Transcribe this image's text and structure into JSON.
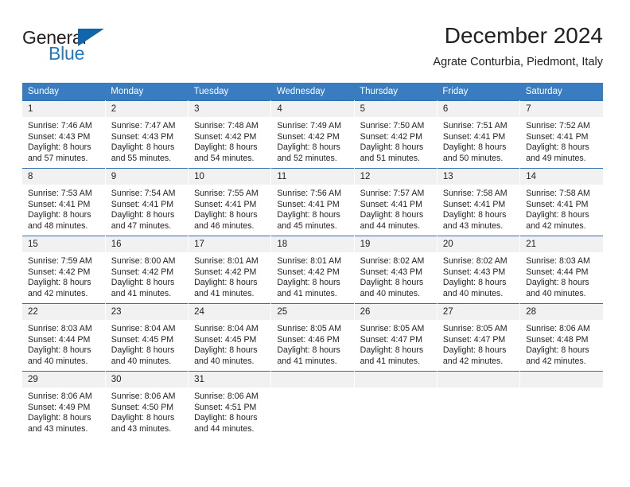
{
  "brand": {
    "name_top": "General",
    "name_bottom": "Blue",
    "triangle_icon": "blue-triangle-logo-mark",
    "accent_color": "#1166ab",
    "text_color": "#231f20"
  },
  "header": {
    "title": "December 2024",
    "location": "Agrate Conturbia, Piedmont, Italy"
  },
  "calendar": {
    "header_bg": "#3a7cc0",
    "header_text_color": "#ffffff",
    "daynum_bg": "#f1f1f1",
    "row_divider_color": "#2f6fb5",
    "weekdays": [
      "Sunday",
      "Monday",
      "Tuesday",
      "Wednesday",
      "Thursday",
      "Friday",
      "Saturday"
    ],
    "weeks": [
      [
        {
          "day": "1",
          "sunrise": "Sunrise: 7:46 AM",
          "sunset": "Sunset: 4:43 PM",
          "daylight_1": "Daylight: 8 hours",
          "daylight_2": "and 57 minutes."
        },
        {
          "day": "2",
          "sunrise": "Sunrise: 7:47 AM",
          "sunset": "Sunset: 4:43 PM",
          "daylight_1": "Daylight: 8 hours",
          "daylight_2": "and 55 minutes."
        },
        {
          "day": "3",
          "sunrise": "Sunrise: 7:48 AM",
          "sunset": "Sunset: 4:42 PM",
          "daylight_1": "Daylight: 8 hours",
          "daylight_2": "and 54 minutes."
        },
        {
          "day": "4",
          "sunrise": "Sunrise: 7:49 AM",
          "sunset": "Sunset: 4:42 PM",
          "daylight_1": "Daylight: 8 hours",
          "daylight_2": "and 52 minutes."
        },
        {
          "day": "5",
          "sunrise": "Sunrise: 7:50 AM",
          "sunset": "Sunset: 4:42 PM",
          "daylight_1": "Daylight: 8 hours",
          "daylight_2": "and 51 minutes."
        },
        {
          "day": "6",
          "sunrise": "Sunrise: 7:51 AM",
          "sunset": "Sunset: 4:41 PM",
          "daylight_1": "Daylight: 8 hours",
          "daylight_2": "and 50 minutes."
        },
        {
          "day": "7",
          "sunrise": "Sunrise: 7:52 AM",
          "sunset": "Sunset: 4:41 PM",
          "daylight_1": "Daylight: 8 hours",
          "daylight_2": "and 49 minutes."
        }
      ],
      [
        {
          "day": "8",
          "sunrise": "Sunrise: 7:53 AM",
          "sunset": "Sunset: 4:41 PM",
          "daylight_1": "Daylight: 8 hours",
          "daylight_2": "and 48 minutes."
        },
        {
          "day": "9",
          "sunrise": "Sunrise: 7:54 AM",
          "sunset": "Sunset: 4:41 PM",
          "daylight_1": "Daylight: 8 hours",
          "daylight_2": "and 47 minutes."
        },
        {
          "day": "10",
          "sunrise": "Sunrise: 7:55 AM",
          "sunset": "Sunset: 4:41 PM",
          "daylight_1": "Daylight: 8 hours",
          "daylight_2": "and 46 minutes."
        },
        {
          "day": "11",
          "sunrise": "Sunrise: 7:56 AM",
          "sunset": "Sunset: 4:41 PM",
          "daylight_1": "Daylight: 8 hours",
          "daylight_2": "and 45 minutes."
        },
        {
          "day": "12",
          "sunrise": "Sunrise: 7:57 AM",
          "sunset": "Sunset: 4:41 PM",
          "daylight_1": "Daylight: 8 hours",
          "daylight_2": "and 44 minutes."
        },
        {
          "day": "13",
          "sunrise": "Sunrise: 7:58 AM",
          "sunset": "Sunset: 4:41 PM",
          "daylight_1": "Daylight: 8 hours",
          "daylight_2": "and 43 minutes."
        },
        {
          "day": "14",
          "sunrise": "Sunrise: 7:58 AM",
          "sunset": "Sunset: 4:41 PM",
          "daylight_1": "Daylight: 8 hours",
          "daylight_2": "and 42 minutes."
        }
      ],
      [
        {
          "day": "15",
          "sunrise": "Sunrise: 7:59 AM",
          "sunset": "Sunset: 4:42 PM",
          "daylight_1": "Daylight: 8 hours",
          "daylight_2": "and 42 minutes."
        },
        {
          "day": "16",
          "sunrise": "Sunrise: 8:00 AM",
          "sunset": "Sunset: 4:42 PM",
          "daylight_1": "Daylight: 8 hours",
          "daylight_2": "and 41 minutes."
        },
        {
          "day": "17",
          "sunrise": "Sunrise: 8:01 AM",
          "sunset": "Sunset: 4:42 PM",
          "daylight_1": "Daylight: 8 hours",
          "daylight_2": "and 41 minutes."
        },
        {
          "day": "18",
          "sunrise": "Sunrise: 8:01 AM",
          "sunset": "Sunset: 4:42 PM",
          "daylight_1": "Daylight: 8 hours",
          "daylight_2": "and 41 minutes."
        },
        {
          "day": "19",
          "sunrise": "Sunrise: 8:02 AM",
          "sunset": "Sunset: 4:43 PM",
          "daylight_1": "Daylight: 8 hours",
          "daylight_2": "and 40 minutes."
        },
        {
          "day": "20",
          "sunrise": "Sunrise: 8:02 AM",
          "sunset": "Sunset: 4:43 PM",
          "daylight_1": "Daylight: 8 hours",
          "daylight_2": "and 40 minutes."
        },
        {
          "day": "21",
          "sunrise": "Sunrise: 8:03 AM",
          "sunset": "Sunset: 4:44 PM",
          "daylight_1": "Daylight: 8 hours",
          "daylight_2": "and 40 minutes."
        }
      ],
      [
        {
          "day": "22",
          "sunrise": "Sunrise: 8:03 AM",
          "sunset": "Sunset: 4:44 PM",
          "daylight_1": "Daylight: 8 hours",
          "daylight_2": "and 40 minutes."
        },
        {
          "day": "23",
          "sunrise": "Sunrise: 8:04 AM",
          "sunset": "Sunset: 4:45 PM",
          "daylight_1": "Daylight: 8 hours",
          "daylight_2": "and 40 minutes."
        },
        {
          "day": "24",
          "sunrise": "Sunrise: 8:04 AM",
          "sunset": "Sunset: 4:45 PM",
          "daylight_1": "Daylight: 8 hours",
          "daylight_2": "and 40 minutes."
        },
        {
          "day": "25",
          "sunrise": "Sunrise: 8:05 AM",
          "sunset": "Sunset: 4:46 PM",
          "daylight_1": "Daylight: 8 hours",
          "daylight_2": "and 41 minutes."
        },
        {
          "day": "26",
          "sunrise": "Sunrise: 8:05 AM",
          "sunset": "Sunset: 4:47 PM",
          "daylight_1": "Daylight: 8 hours",
          "daylight_2": "and 41 minutes."
        },
        {
          "day": "27",
          "sunrise": "Sunrise: 8:05 AM",
          "sunset": "Sunset: 4:47 PM",
          "daylight_1": "Daylight: 8 hours",
          "daylight_2": "and 42 minutes."
        },
        {
          "day": "28",
          "sunrise": "Sunrise: 8:06 AM",
          "sunset": "Sunset: 4:48 PM",
          "daylight_1": "Daylight: 8 hours",
          "daylight_2": "and 42 minutes."
        }
      ],
      [
        {
          "day": "29",
          "sunrise": "Sunrise: 8:06 AM",
          "sunset": "Sunset: 4:49 PM",
          "daylight_1": "Daylight: 8 hours",
          "daylight_2": "and 43 minutes."
        },
        {
          "day": "30",
          "sunrise": "Sunrise: 8:06 AM",
          "sunset": "Sunset: 4:50 PM",
          "daylight_1": "Daylight: 8 hours",
          "daylight_2": "and 43 minutes."
        },
        {
          "day": "31",
          "sunrise": "Sunrise: 8:06 AM",
          "sunset": "Sunset: 4:51 PM",
          "daylight_1": "Daylight: 8 hours",
          "daylight_2": "and 44 minutes."
        },
        {
          "day": "",
          "sunrise": "",
          "sunset": "",
          "daylight_1": "",
          "daylight_2": ""
        },
        {
          "day": "",
          "sunrise": "",
          "sunset": "",
          "daylight_1": "",
          "daylight_2": ""
        },
        {
          "day": "",
          "sunrise": "",
          "sunset": "",
          "daylight_1": "",
          "daylight_2": ""
        },
        {
          "day": "",
          "sunrise": "",
          "sunset": "",
          "daylight_1": "",
          "daylight_2": ""
        }
      ]
    ]
  }
}
